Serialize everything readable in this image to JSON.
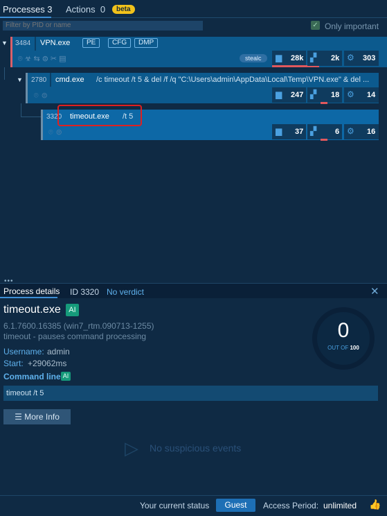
{
  "tabs": {
    "processes_label": "Processes 3",
    "actions_label": "Actions",
    "actions_count": "0",
    "beta_badge": "beta"
  },
  "filter": {
    "placeholder": "Filter by PID or name",
    "only_important_label": "Only important",
    "only_important_checked": true
  },
  "processes": [
    {
      "pid": "3484",
      "name": "VPN.exe",
      "tags": [
        "PE",
        "CFG",
        "DMP"
      ],
      "badge": "stealc",
      "stats": {
        "files": "28k",
        "registry": "2k",
        "modules": "303"
      }
    },
    {
      "pid": "2780",
      "name": "cmd.exe",
      "args": "/c timeout /t 5 & del /f /q \"C:\\Users\\admin\\AppData\\Local\\Temp\\VPN.exe\" & del ...",
      "stats": {
        "files": "247",
        "registry": "18",
        "modules": "14"
      }
    },
    {
      "pid": "3320",
      "name": "timeout.exe",
      "args": "/t 5",
      "stats": {
        "files": "37",
        "registry": "6",
        "modules": "16"
      }
    }
  ],
  "details": {
    "header_label": "Process details",
    "id_label": "ID 3320",
    "verdict_label": "No verdict",
    "process_name": "timeout.exe",
    "ai_badge": "AI",
    "version": "6.1.7600.16385 (win7_rtm.090713-1255)",
    "description": "timeout - pauses command processing",
    "username_label": "Username:",
    "username_value": "admin",
    "start_label": "Start:",
    "start_value": "+29062ms",
    "cmdline_label": "Command line",
    "cmdline_value": "timeout /t 5",
    "more_info_label": "More Info",
    "score": "0",
    "score_out_of": "OUT OF",
    "score_max": "100",
    "no_events_label": "No suspicious events"
  },
  "footer": {
    "status_label": "Your current status",
    "status_button": "Guest",
    "access_label": "Access Period:",
    "access_value": "unlimited"
  },
  "colors": {
    "background": "#0f2a44",
    "row_bg": "#0c5a8e",
    "accent": "#3d8fd6",
    "danger_bar": "#e0585d",
    "beta": "#f1c21b",
    "ai_badge": "#169b7b"
  }
}
